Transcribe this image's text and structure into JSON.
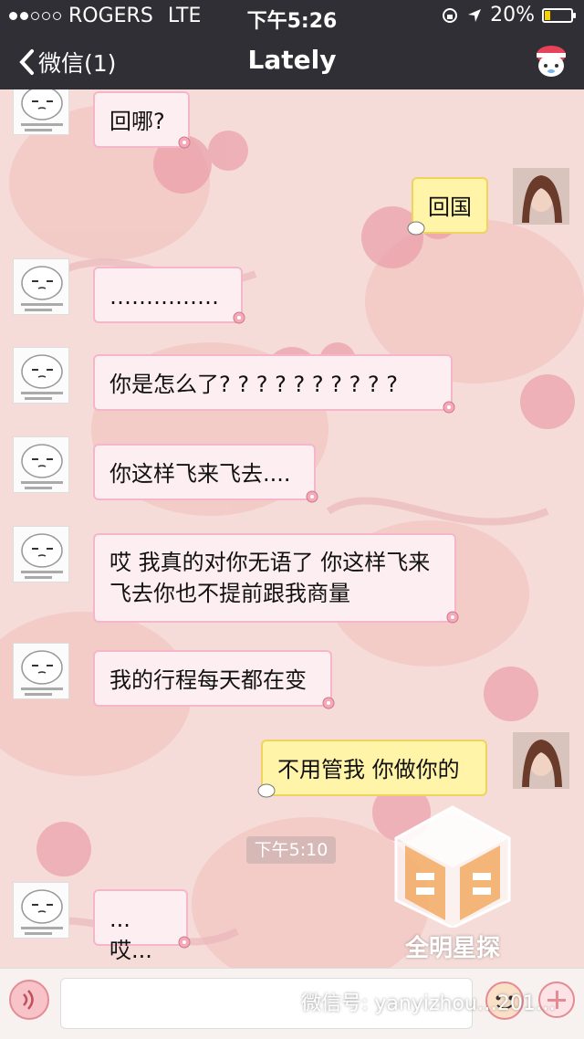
{
  "status_bar": {
    "carrier": "ROGERS",
    "network": "LTE",
    "time": "下午5:26",
    "battery": "20%",
    "battery_level": 0.2,
    "signal_dots_filled": 2,
    "signal_dots_total": 5
  },
  "nav": {
    "back_label": "微信(1)",
    "title": "Lately"
  },
  "messages": [
    {
      "side": "left",
      "text": "回哪?"
    },
    {
      "side": "right",
      "text": "回国"
    },
    {
      "side": "left",
      "text": "……………"
    },
    {
      "side": "left",
      "text": "你是怎么了? ? ? ? ? ? ? ? ? ?"
    },
    {
      "side": "left",
      "text": "你这样飞来飞去...."
    },
    {
      "side": "left",
      "text": "哎 我真的对你无语了 你这样飞来飞去你也不提前跟我商量"
    },
    {
      "side": "left",
      "text": "我的行程每天都在变"
    },
    {
      "side": "right",
      "text": "不用管我 你做你的"
    },
    {
      "side": "left",
      "text": "...哎..."
    }
  ],
  "timestamp": "下午5:10",
  "watermark": {
    "brand": "全明星探",
    "wechat_id": "微信号: yanyizhou…201…"
  },
  "colors": {
    "nav_bg": "#2f2f35",
    "left_bubble": "#fdeef2",
    "right_bubble": "#fff4a8",
    "background": "#f6dcd8"
  }
}
